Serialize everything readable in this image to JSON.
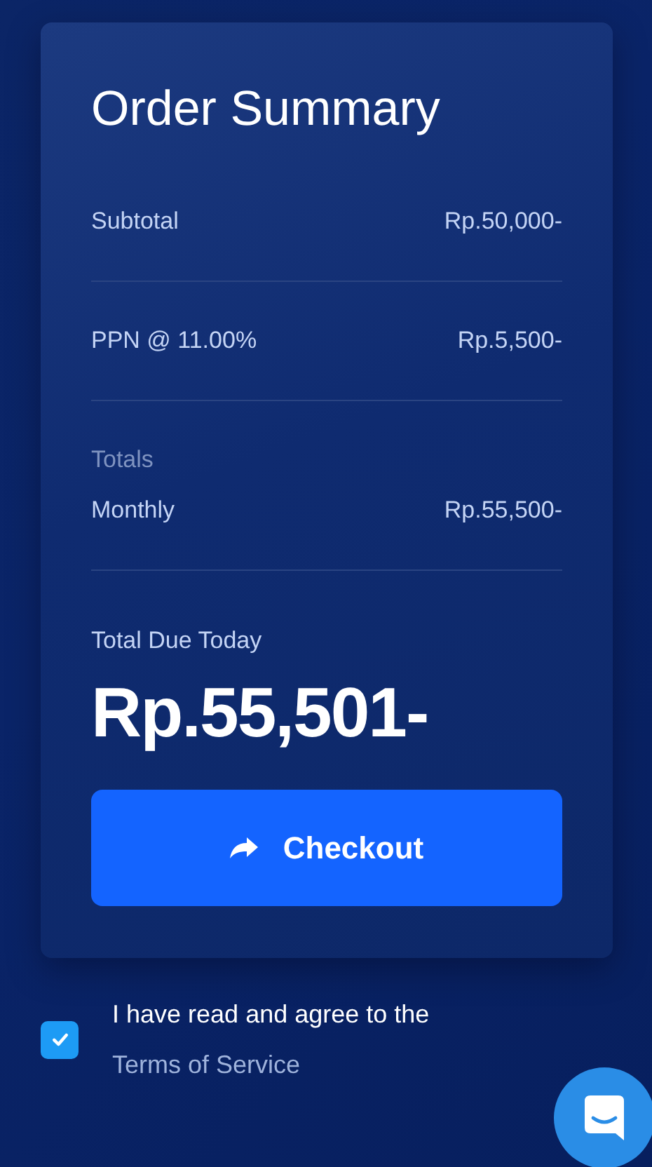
{
  "summary": {
    "title": "Order Summary",
    "lines": [
      {
        "label": "Subtotal",
        "amount": "Rp.50,000-"
      },
      {
        "label": "PPN @ 11.00%",
        "amount": "Rp.5,500-"
      }
    ],
    "totals": {
      "heading": "Totals",
      "lines": [
        {
          "label": "Monthly",
          "amount": "Rp.55,500-"
        }
      ]
    },
    "due": {
      "label": "Total Due Today",
      "amount": "Rp.55,501-"
    },
    "checkout": {
      "label": "Checkout"
    }
  },
  "agreement": {
    "checked": true,
    "text": "I have read and agree to the ",
    "link": "Terms of Service"
  }
}
